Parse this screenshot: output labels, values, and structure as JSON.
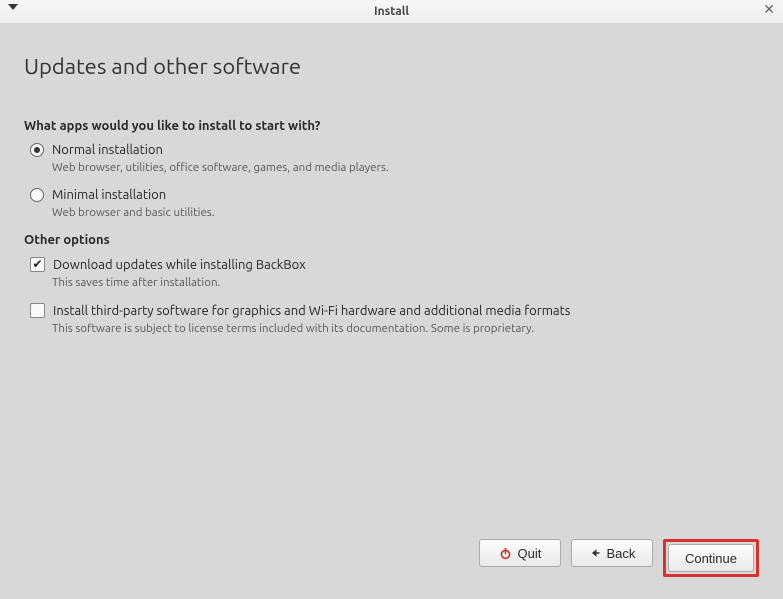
{
  "window": {
    "title": "Install"
  },
  "page": {
    "heading": "Updates and other software",
    "question": "What apps would you like to install to start with?"
  },
  "install_options": [
    {
      "label": "Normal installation",
      "description": "Web browser, utilities, office software, games, and media players.",
      "selected": true
    },
    {
      "label": "Minimal installation",
      "description": "Web browser and basic utilities.",
      "selected": false
    }
  ],
  "other_options_label": "Other options",
  "other_options": [
    {
      "label": "Download updates while installing BackBox",
      "description": "This saves time after installation.",
      "checked": true
    },
    {
      "label": "Install third-party software for graphics and Wi-Fi hardware and additional media formats",
      "description": "This software is subject to license terms included with its documentation. Some is proprietary.",
      "checked": false
    }
  ],
  "buttons": {
    "quit": "Quit",
    "back": "Back",
    "continue": "Continue"
  }
}
